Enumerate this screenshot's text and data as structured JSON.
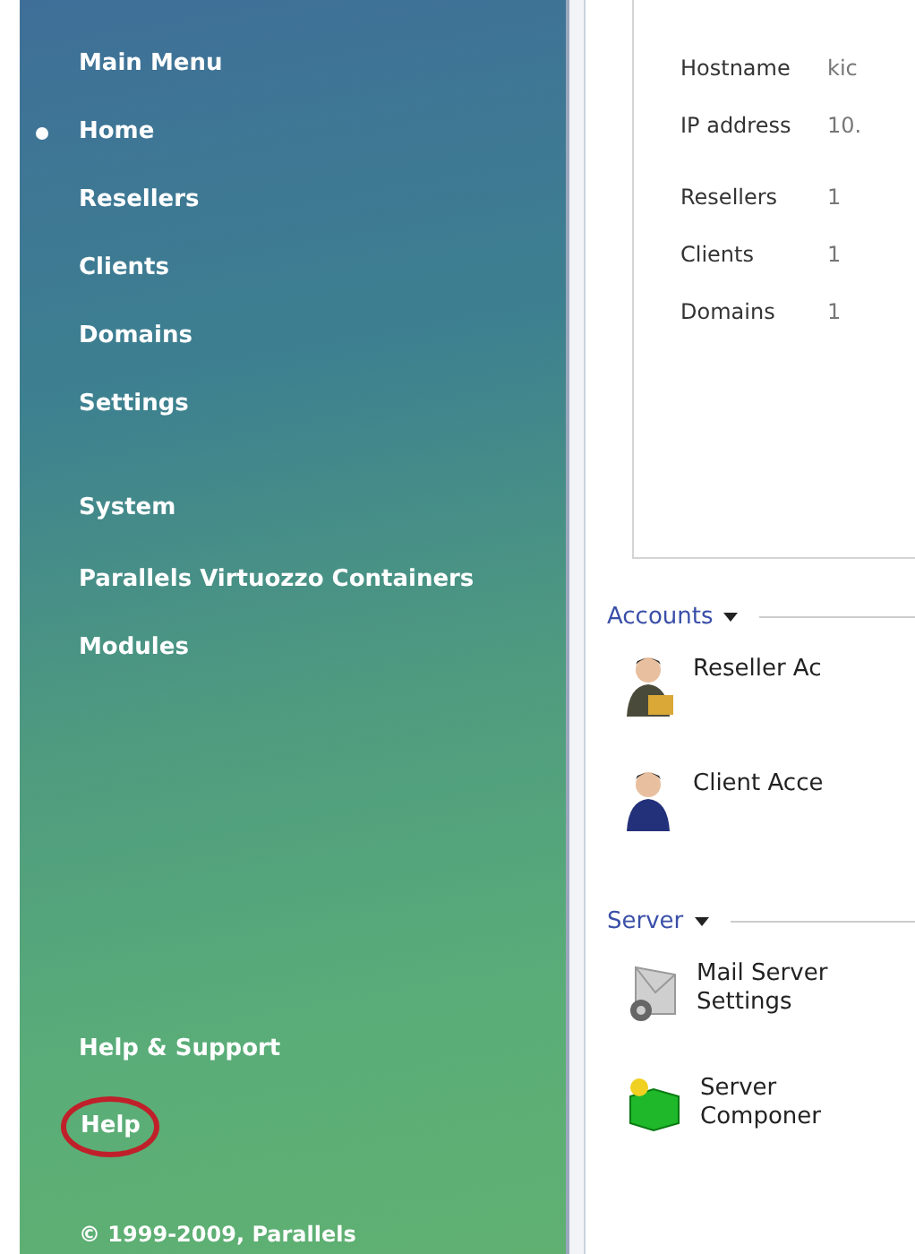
{
  "sidebar": {
    "heading": "Main Menu",
    "items": [
      {
        "label": "Home",
        "selected": true
      },
      {
        "label": "Resellers",
        "selected": false
      },
      {
        "label": "Clients",
        "selected": false
      },
      {
        "label": "Domains",
        "selected": false
      },
      {
        "label": "Settings",
        "selected": false
      }
    ],
    "system_heading": "System",
    "system_items": [
      {
        "label": "Parallels Virtuozzo Containers",
        "selected": false
      },
      {
        "label": "Modules",
        "selected": false
      }
    ],
    "help_heading": "Help & Support",
    "help_items": [
      {
        "label": "Help",
        "circled": true
      }
    ],
    "copyright": "© 1999-2009, Parallels"
  },
  "info": {
    "host_rows": [
      {
        "label": "Hostname",
        "value": "kic"
      },
      {
        "label": "IP address",
        "value": "10."
      }
    ],
    "count_rows": [
      {
        "label": "Resellers",
        "value": "1"
      },
      {
        "label": "Clients",
        "value": "1"
      },
      {
        "label": "Domains",
        "value": "1"
      }
    ]
  },
  "sections": [
    {
      "title": "Accounts",
      "items": [
        {
          "kind": "reseller",
          "label": "Reseller Ac"
        },
        {
          "kind": "client",
          "label": "Client Acce"
        }
      ]
    },
    {
      "title": "Server",
      "items": [
        {
          "kind": "mail",
          "label": "Mail Server Settings"
        },
        {
          "kind": "components",
          "label": "Server Componer"
        }
      ]
    }
  ]
}
